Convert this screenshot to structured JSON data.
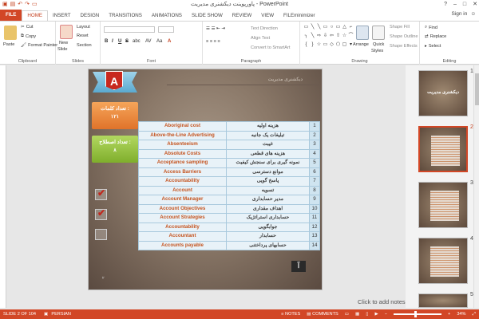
{
  "window": {
    "title": "پاورپوینت دیکشنری مدیریت - PowerPoint",
    "controls": [
      "?",
      "–",
      "□",
      "✕"
    ]
  },
  "tabs": [
    "FILE",
    "HOME",
    "INSERT",
    "DESIGN",
    "TRANSITIONS",
    "ANIMATIONS",
    "SLIDE SHOW",
    "REVIEW",
    "VIEW",
    "FILEminimizer"
  ],
  "active_tab": "HOME",
  "account": {
    "signin": "Sign in"
  },
  "ribbon": {
    "clipboard": {
      "label": "Clipboard",
      "paste": "Paste",
      "cut": "Cut",
      "copy": "Copy",
      "format_painter": "Format Painter"
    },
    "slides": {
      "label": "Slides",
      "new_slide": "New",
      "new_slide2": "Slide",
      "layout": "Layout",
      "reset": "Reset",
      "section": "Section"
    },
    "font": {
      "label": "Font",
      "bold": "B",
      "italic": "I",
      "underline": "U",
      "strike": "S",
      "shadow": "abc",
      "spacing": "AV",
      "case": "Aa",
      "color": "A"
    },
    "paragraph": {
      "label": "Paragraph",
      "text_direction": "Text Direction",
      "align_text": "Align Text",
      "smartart": "Convert to SmartArt"
    },
    "drawing": {
      "label": "Drawing",
      "arrange": "Arrange",
      "quick_styles": "Quick",
      "quick_styles2": "Styles",
      "shape_fill": "Shape Fill",
      "shape_outline": "Shape Outline",
      "shape_effects": "Shape Effects"
    },
    "editing": {
      "label": "Editing",
      "find": "Find",
      "replace": "Replace",
      "select": "Select"
    }
  },
  "slide": {
    "header": "دیکشنری مدیریت",
    "badge_letter": "A",
    "word_count_label": "تعداد کلمات :",
    "word_count_value": "۱۲۱",
    "phrase_count_label": "تعداد اصطلاح :",
    "phrase_count_value": "۸",
    "logo_text": "آ",
    "page_hint": "۲",
    "rows": [
      {
        "en": "Aboriginal cost",
        "fa": "هزینه اولیه",
        "n": "1"
      },
      {
        "en": "Above-the-Line Advertising",
        "fa": "تبلیغات یک جانبه",
        "n": "2"
      },
      {
        "en": "Absenteeism",
        "fa": "غیبت",
        "n": "3"
      },
      {
        "en": "Absolute Costs",
        "fa": "هزینه های قطعی",
        "n": "4"
      },
      {
        "en": "Acceptance sampling",
        "fa": "نمونه گیری برای سنجش کیفیت",
        "n": "5"
      },
      {
        "en": "Access Barriers",
        "fa": "موانع دسترسی",
        "n": "6"
      },
      {
        "en": "Accountability",
        "fa": "پاسخ گویی",
        "n": "7"
      },
      {
        "en": "Account",
        "fa": "تسویه",
        "n": "8"
      },
      {
        "en": "Account Manager",
        "fa": "مدیر حسابداری",
        "n": "9"
      },
      {
        "en": "Account Objectives",
        "fa": "اهداف مقداری",
        "n": "10"
      },
      {
        "en": "Account Strategies",
        "fa": "حسابداری استراتژیک",
        "n": "11"
      },
      {
        "en": "Accountability",
        "fa": "جوابگویی",
        "n": "12"
      },
      {
        "en": "Accountant",
        "fa": "حسابدار",
        "n": "13"
      },
      {
        "en": "Accounts payable",
        "fa": "حسابهای پرداختنی",
        "n": "14"
      }
    ]
  },
  "thumbnails": [
    {
      "num": "1",
      "title": "دیکشنری مدیریت"
    },
    {
      "num": "2",
      "title": ""
    },
    {
      "num": "3",
      "title": ""
    },
    {
      "num": "4",
      "title": ""
    },
    {
      "num": "5",
      "title": ""
    }
  ],
  "selected_slide": "2",
  "notes_placeholder": "Click to add notes",
  "status": {
    "slide_of": "SLIDE 2 OF 104",
    "language": "PERSIAN",
    "notes": "NOTES",
    "comments": "COMMENTS",
    "zoom_minus": "−",
    "zoom_plus": "+",
    "zoom": "34%"
  },
  "colors": {
    "accent": "#d24726",
    "table_en": "#c5531e",
    "table_bg": "#e8f2f8"
  }
}
